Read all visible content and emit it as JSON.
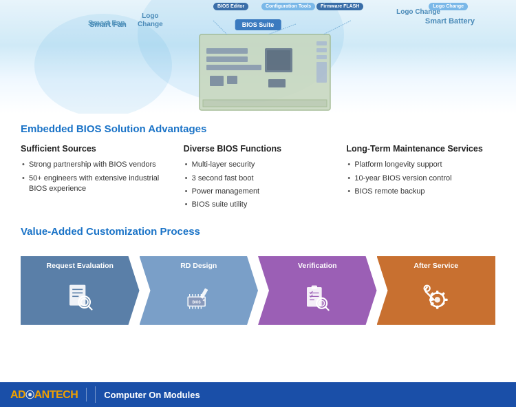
{
  "diagram": {
    "labels": {
      "smart_fan": "Smart Fan",
      "logo_change_left": "Logo\nChange",
      "logo_change_right": "Logo Change",
      "smart_battery": "Smart Battery",
      "bios_suite": "BIOS Suite",
      "firmware_flash": "Firmware FLASH",
      "configuration_tools": "Configuration Tools",
      "bios_editor": "BIOS Editor"
    }
  },
  "advantages": {
    "section_title": "Embedded BIOS Solution Advantages",
    "col1": {
      "title": "Sufficient Sources",
      "bullets": [
        "Strong partnership with BIOS vendors",
        "50+ engineers with extensive industrial BIOS experience"
      ]
    },
    "col2": {
      "title": "Diverse BIOS Functions",
      "bullets": [
        "Multi-layer security",
        "3 second fast boot",
        "Power management",
        "BIOS suite utility"
      ]
    },
    "col3": {
      "title": "Long-Term Maintenance Services",
      "bullets": [
        "Platform longevity support",
        "10-year BIOS version control",
        "BIOS remote backup"
      ]
    }
  },
  "process": {
    "section_title": "Value-Added Customization Process",
    "steps": [
      {
        "id": "step1",
        "label": "Request Evaluation",
        "color": "color-1",
        "icon": "search-doc-icon"
      },
      {
        "id": "step2",
        "label": "RD Design",
        "color": "color-2",
        "icon": "bios-chip-icon"
      },
      {
        "id": "step3",
        "label": "Verification",
        "color": "color-3",
        "icon": "checklist-magnify-icon"
      },
      {
        "id": "step4",
        "label": "After Service",
        "color": "color-4",
        "icon": "wrench-gear-icon"
      }
    ]
  },
  "footer": {
    "logo": "AD⦿ANTECH",
    "logo_display": "ADVANTECH",
    "product": "Computer On Modules"
  }
}
